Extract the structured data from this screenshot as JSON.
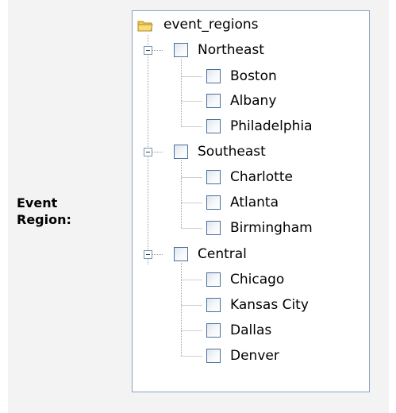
{
  "form": {
    "label_line1": "Event",
    "label_line2": "Region:"
  },
  "tree": {
    "root": {
      "label": "event_regions",
      "icon": "folder-icon"
    },
    "regions": [
      {
        "label": "Northeast",
        "expanded": true,
        "checked": false,
        "cities": [
          {
            "label": "Boston",
            "checked": false
          },
          {
            "label": "Albany",
            "checked": false
          },
          {
            "label": "Philadelphia",
            "checked": false
          }
        ]
      },
      {
        "label": "Southeast",
        "expanded": true,
        "checked": false,
        "cities": [
          {
            "label": "Charlotte",
            "checked": false
          },
          {
            "label": "Atlanta",
            "checked": false
          },
          {
            "label": "Birmingham",
            "checked": false
          }
        ]
      },
      {
        "label": "Central",
        "expanded": true,
        "checked": false,
        "cities": [
          {
            "label": "Chicago",
            "checked": false
          },
          {
            "label": "Kansas City",
            "checked": false
          },
          {
            "label": "Dallas",
            "checked": false
          },
          {
            "label": "Denver",
            "checked": false
          }
        ]
      }
    ]
  },
  "colors": {
    "panel_background": "#f3f3f3",
    "tree_border": "#8aa2c0",
    "checkbox_border": "#4b6f9c",
    "connector": "#a0a0a0",
    "folder": "#f2c94c"
  }
}
